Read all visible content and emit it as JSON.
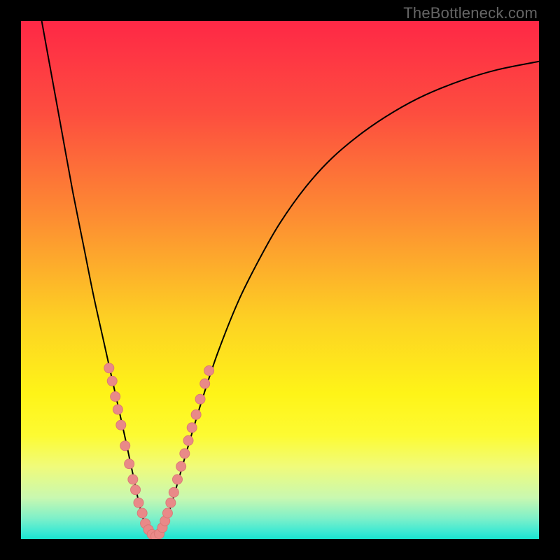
{
  "watermark": "TheBottleneck.com",
  "colors": {
    "frame": "#000000",
    "curve": "#000000",
    "marker_fill": "#e98988",
    "marker_stroke": "#d97775"
  },
  "chart_data": {
    "type": "line",
    "title": "",
    "xlabel": "",
    "ylabel": "",
    "xlim": [
      0,
      100
    ],
    "ylim": [
      0,
      100
    ],
    "gradient_stops": [
      {
        "pct": 0,
        "color": "#fe2846"
      },
      {
        "pct": 18,
        "color": "#fd4e3f"
      },
      {
        "pct": 38,
        "color": "#fd8d32"
      },
      {
        "pct": 58,
        "color": "#fdd223"
      },
      {
        "pct": 72,
        "color": "#fef418"
      },
      {
        "pct": 80,
        "color": "#fdfb32"
      },
      {
        "pct": 86,
        "color": "#f0fb7a"
      },
      {
        "pct": 92,
        "color": "#c9f8b0"
      },
      {
        "pct": 96,
        "color": "#7ef0c9"
      },
      {
        "pct": 99,
        "color": "#33e8d4"
      },
      {
        "pct": 100,
        "color": "#19e4cf"
      }
    ],
    "series": [
      {
        "name": "bottleneck-curve",
        "x": [
          4,
          6,
          8,
          10,
          12,
          14,
          16,
          18,
          20,
          21.5,
          23,
          24.5,
          26,
          27,
          28.5,
          30,
          32,
          35,
          38,
          42,
          46,
          50,
          55,
          60,
          66,
          72,
          78,
          85,
          92,
          100
        ],
        "y": [
          100,
          89,
          78,
          67,
          57,
          47,
          38,
          29,
          20,
          13,
          6,
          1.5,
          0.5,
          1.5,
          5,
          10,
          17,
          27,
          36,
          46,
          54,
          61,
          68,
          73.5,
          78.5,
          82.5,
          85.7,
          88.5,
          90.6,
          92.2
        ]
      }
    ],
    "markers": {
      "name": "highlight-dots",
      "points": [
        {
          "x": 17.0,
          "y": 33.0
        },
        {
          "x": 17.6,
          "y": 30.5
        },
        {
          "x": 18.2,
          "y": 27.5
        },
        {
          "x": 18.7,
          "y": 25.0
        },
        {
          "x": 19.3,
          "y": 22.0
        },
        {
          "x": 20.1,
          "y": 18.0
        },
        {
          "x": 20.9,
          "y": 14.5
        },
        {
          "x": 21.6,
          "y": 11.5
        },
        {
          "x": 22.1,
          "y": 9.5
        },
        {
          "x": 22.7,
          "y": 7.0
        },
        {
          "x": 23.4,
          "y": 5.0
        },
        {
          "x": 24.0,
          "y": 3.0
        },
        {
          "x": 24.6,
          "y": 1.8
        },
        {
          "x": 25.3,
          "y": 0.9
        },
        {
          "x": 26.0,
          "y": 0.5
        },
        {
          "x": 26.7,
          "y": 1.0
        },
        {
          "x": 27.3,
          "y": 2.2
        },
        {
          "x": 27.8,
          "y": 3.5
        },
        {
          "x": 28.3,
          "y": 5.0
        },
        {
          "x": 28.9,
          "y": 7.0
        },
        {
          "x": 29.5,
          "y": 9.0
        },
        {
          "x": 30.2,
          "y": 11.5
        },
        {
          "x": 30.9,
          "y": 14.0
        },
        {
          "x": 31.6,
          "y": 16.5
        },
        {
          "x": 32.3,
          "y": 19.0
        },
        {
          "x": 33.0,
          "y": 21.5
        },
        {
          "x": 33.8,
          "y": 24.0
        },
        {
          "x": 34.6,
          "y": 27.0
        },
        {
          "x": 35.5,
          "y": 30.0
        },
        {
          "x": 36.3,
          "y": 32.5
        }
      ]
    }
  }
}
